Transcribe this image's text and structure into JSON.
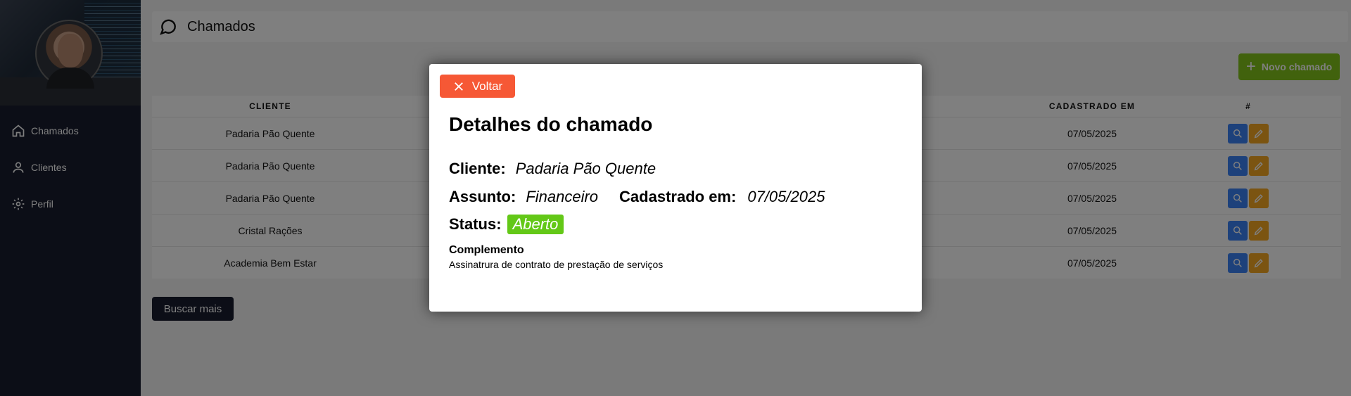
{
  "sidebar": {
    "items": [
      {
        "label": "Chamados",
        "icon": "home-icon"
      },
      {
        "label": "Clientes",
        "icon": "user-icon"
      },
      {
        "label": "Perfil",
        "icon": "gear-icon"
      }
    ]
  },
  "header": {
    "title": "Chamados",
    "icon": "chat-bubble-icon"
  },
  "toolbar": {
    "new_label": "Novo chamado"
  },
  "table": {
    "columns": [
      "CLIENTE",
      "",
      "CADASTRADO EM",
      "#"
    ],
    "rows": [
      {
        "cliente": "Padaria Pão Quente",
        "cadastrado": "07/05/2025"
      },
      {
        "cliente": "Padaria Pão Quente",
        "cadastrado": "07/05/2025"
      },
      {
        "cliente": "Padaria Pão Quente",
        "cadastrado": "07/05/2025"
      },
      {
        "cliente": "Cristal Rações",
        "cadastrado": "07/05/2025"
      },
      {
        "cliente": "Academia Bem Estar",
        "cadastrado": "07/05/2025"
      }
    ]
  },
  "more_label": "Buscar mais",
  "modal": {
    "back_label": "Voltar",
    "title": "Detalhes do chamado",
    "cliente_label": "Cliente:",
    "cliente": "Padaria Pão Quente",
    "assunto_label": "Assunto:",
    "assunto": "Financeiro",
    "cadastrado_label": "Cadastrado em:",
    "cadastrado": "07/05/2025",
    "status_label": "Status:",
    "status": "Aberto",
    "complemento_label": "Complemento",
    "complemento": "Assinatrura de contrato de prestação de serviços"
  },
  "colors": {
    "sidebar": "#181c2e",
    "new_button": "#83c41a",
    "back_button": "#f65835",
    "status_open": "#63c817",
    "search_action": "#3b82f6",
    "edit_action": "#f6a823"
  }
}
